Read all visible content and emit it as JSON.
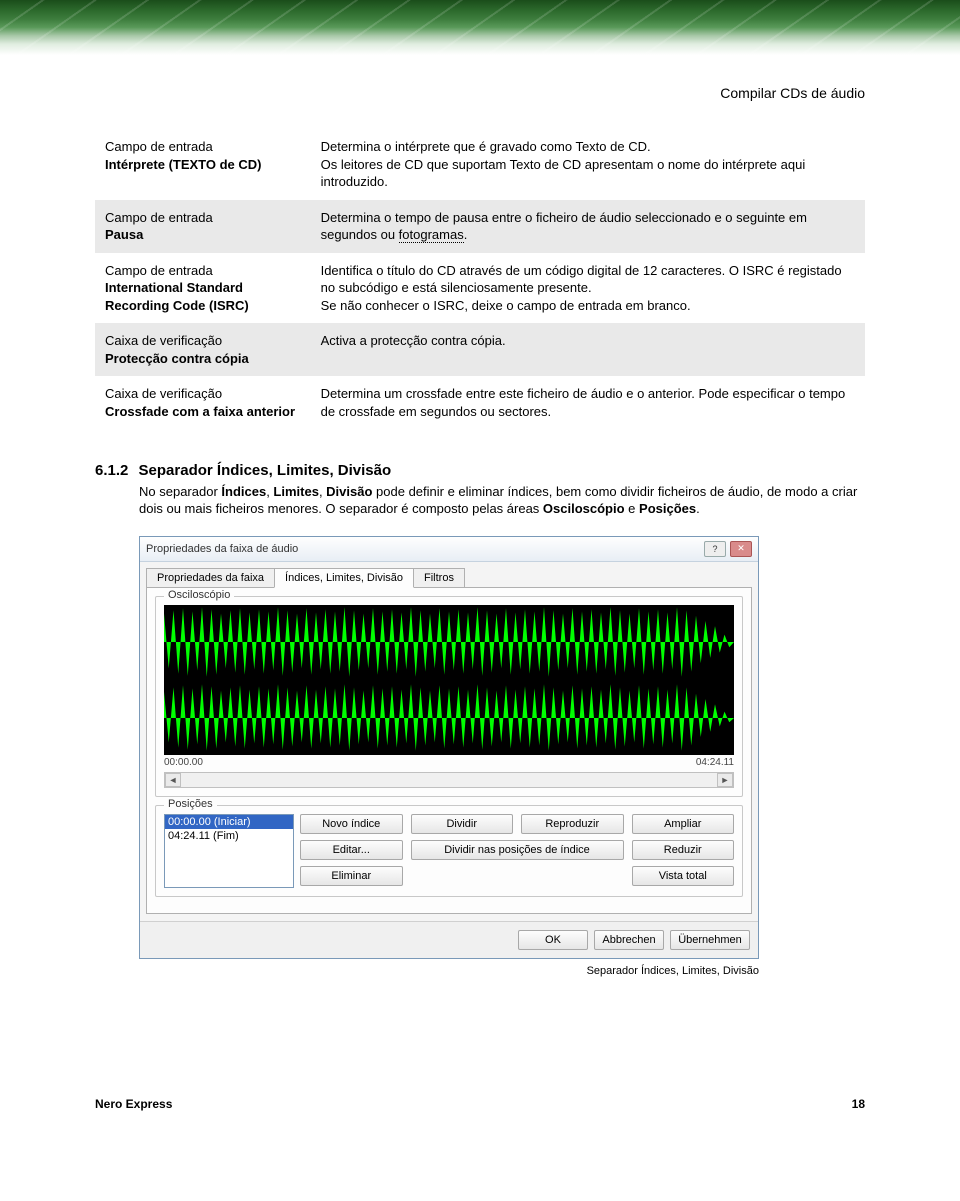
{
  "chapter_title": "Compilar CDs de áudio",
  "table_rows": [
    {
      "left_label": "Campo de entrada",
      "left_name": "Intérprete (TEXTO de CD)",
      "right_line1": "Determina o intérprete que é gravado como Texto de CD.",
      "right_line2": "Os leitores de CD que suportam Texto de CD apresentam o nome do intérprete aqui introduzido."
    },
    {
      "left_label": "Campo de entrada",
      "left_name": "Pausa",
      "right_line1": "Determina o tempo de pausa entre o ficheiro de áudio seleccionado e o seguinte em segundos ou ",
      "right_link": "fotogramas",
      "right_line2": "."
    },
    {
      "left_label": "Campo de entrada",
      "left_name": "International Standard Recording Code (ISRC)",
      "right_line1": "Identifica o título do CD através de um código digital de 12 caracteres. O ISRC é registado no subcódigo e está silenciosamente presente.",
      "right_line2": "Se não conhecer o ISRC, deixe o campo de entrada em branco."
    },
    {
      "left_label": "Caixa de verificação",
      "left_name": "Protecção contra cópia",
      "right_line1": "Activa a protecção contra cópia.",
      "right_line2": ""
    },
    {
      "left_label": "Caixa de verificação",
      "left_name": "Crossfade com a faixa anterior",
      "right_line1": "Determina um crossfade entre este ficheiro de áudio e o anterior. Pode especificar o tempo de crossfade em segundos ou sectores.",
      "right_line2": ""
    }
  ],
  "section": {
    "number": "6.1.2",
    "title": "Separador Índices, Limites, Divisão",
    "body_1": "No separador ",
    "body_bold1": "Índices",
    "body_sep1": ", ",
    "body_bold2": "Limites",
    "body_sep2": ", ",
    "body_bold3": "Divisão",
    "body_2": " pode definir e eliminar índices, bem como dividir ficheiros de áudio, de modo a criar dois ou mais ficheiros menores. O separador é composto pelas áreas ",
    "body_bold4": "Osciloscópio",
    "body_sep3": " e ",
    "body_bold5": "Posições",
    "body_3": "."
  },
  "dialog": {
    "title": "Propriedades da faixa de áudio",
    "tabs": [
      "Propriedades da faixa",
      "Índices, Limites, Divisão",
      "Filtros"
    ],
    "group_oscilloscope": "Osciloscópio",
    "time_start": "00:00.00",
    "time_end": "04:24.11",
    "group_positions": "Posições",
    "list_items": [
      "00:00.00 (Iniciar)",
      "04:24.11 (Fim)"
    ],
    "buttons": {
      "new_index": "Novo índice",
      "dividir": "Dividir",
      "reproduzir": "Reproduzir",
      "ampliar": "Ampliar",
      "editar": "Editar...",
      "dividir_pos": "Dividir nas posições de índice",
      "reduzir": "Reduzir",
      "eliminar": "Eliminar",
      "vista_total": "Vista total"
    },
    "footer": {
      "ok": "OK",
      "cancel": "Abbrechen",
      "apply": "Übernehmen"
    }
  },
  "figure_caption": "Separador Índices, Limites, Divisão",
  "footer": {
    "product": "Nero Express",
    "page": "18"
  }
}
